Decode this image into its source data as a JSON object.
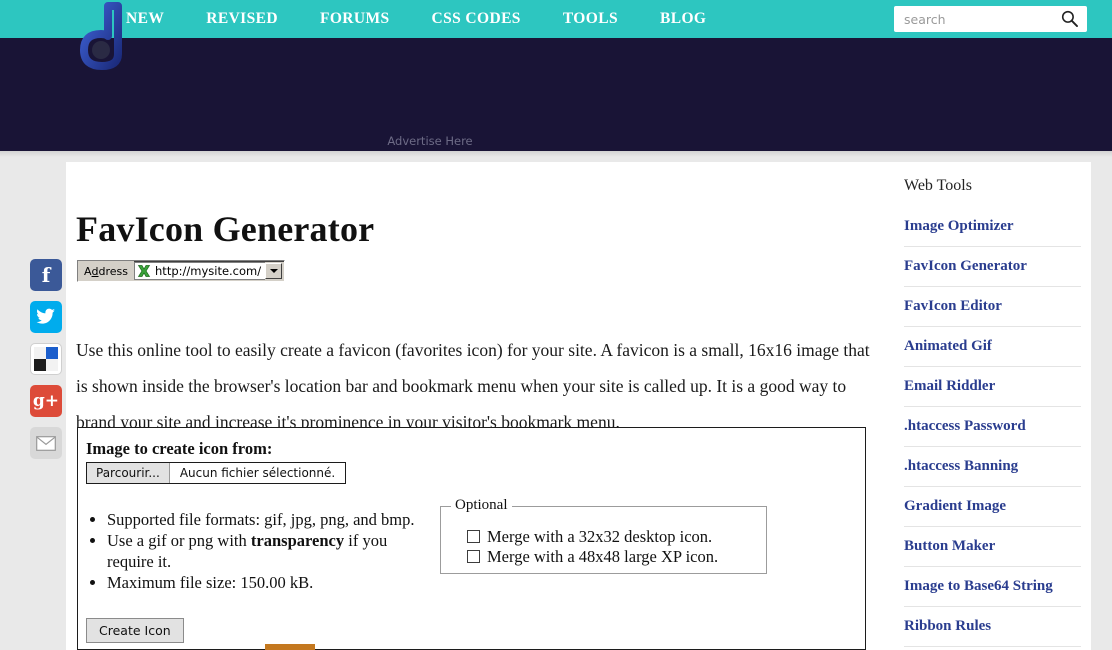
{
  "nav": {
    "logo_letter": "d",
    "items": [
      {
        "label": "NEW"
      },
      {
        "label": "REVISED"
      },
      {
        "label": "FORUMS"
      },
      {
        "label": "CSS CODES"
      },
      {
        "label": "TOOLS"
      },
      {
        "label": "BLOG"
      }
    ],
    "search": {
      "placeholder": "search",
      "value": "",
      "icon": "search-icon"
    },
    "bg_color": "#2dc6c0"
  },
  "banner": {
    "advertise_text": "Advertise Here",
    "bg_color": "#191436"
  },
  "social": [
    {
      "name": "facebook",
      "glyph": "f"
    },
    {
      "name": "twitter",
      "glyph": "✈"
    },
    {
      "name": "delicious",
      "glyph": ""
    },
    {
      "name": "google-plus",
      "glyph": "g+"
    },
    {
      "name": "email",
      "glyph": "✉"
    }
  ],
  "main": {
    "title": "FavIcon Generator",
    "address_bar": {
      "label_before": "A",
      "label_accel": "d",
      "label_after": "dress",
      "url": "http://mysite.com/",
      "icon": "green-app-icon",
      "dropdown_icon": "chevron-down-icon"
    },
    "intro": "Use this online tool to easily create a favicon (favorites icon) for your site. A favicon is a small, 16x16 image that is shown inside the browser's location bar and bookmark menu when your site is called up. It is a good way to brand your site and increase it's prominence in your visitor's bookmark menu.",
    "form": {
      "legend": "Image to create icon from:",
      "file_button": "Parcourir...",
      "file_status": "Aucun fichier sélectionné.",
      "facts": [
        {
          "text": "Supported file formats: gif, jpg, png, and bmp."
        },
        {
          "text_a": "Use a gif or png with ",
          "bold": "transparency",
          "text_b": " if you require it."
        },
        {
          "text": "Maximum file size: 150.00 kB."
        }
      ],
      "optional": {
        "legend": "Optional",
        "checkboxes": [
          {
            "label": "Merge with a 32x32 desktop icon.",
            "checked": false
          },
          {
            "label": "Merge with a 48x48 large XP icon.",
            "checked": false
          }
        ]
      },
      "submit_label": "Create Icon"
    }
  },
  "sidebar": {
    "title": "Web Tools",
    "items": [
      {
        "label": "Image Optimizer"
      },
      {
        "label": "FavIcon Generator"
      },
      {
        "label": "FavIcon Editor"
      },
      {
        "label": "Animated Gif"
      },
      {
        "label": "Email Riddler"
      },
      {
        "label": ".htaccess Password"
      },
      {
        "label": ".htaccess Banning"
      },
      {
        "label": "Gradient Image"
      },
      {
        "label": "Button Maker"
      },
      {
        "label": "Image to Base64 String"
      },
      {
        "label": "Ribbon Rules"
      }
    ],
    "link_color": "#2a3d8f"
  }
}
